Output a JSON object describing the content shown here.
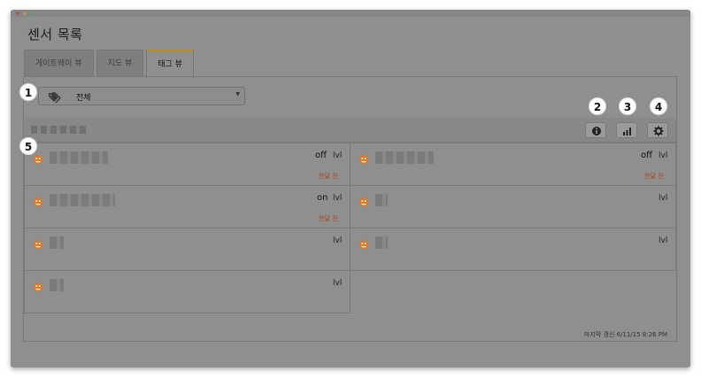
{
  "page": {
    "title": "센서 목록"
  },
  "tabs": [
    {
      "label": "게이트웨이 뷰"
    },
    {
      "label": "지도 뷰"
    },
    {
      "label": "태그 뷰"
    }
  ],
  "filter": {
    "selected": "전체"
  },
  "callouts": [
    "1",
    "2",
    "3",
    "4",
    "5"
  ],
  "toolbar": {
    "info_icon": "info-icon",
    "chart_icon": "chart-icon",
    "settings_icon": "gear-icon"
  },
  "sensors": [
    {
      "status": "off",
      "unit": "lvl",
      "time": "한달 전"
    },
    {
      "status": "off",
      "unit": "lvl",
      "time": "한달 전"
    },
    {
      "status": "on",
      "unit": "lvl",
      "time": "한달 전"
    },
    {
      "status": "",
      "unit": "lvl",
      "time": ""
    },
    {
      "status": "",
      "unit": "lvl",
      "time": ""
    },
    {
      "status": "",
      "unit": "lvl",
      "time": ""
    },
    {
      "status": "",
      "unit": "lvl",
      "time": ""
    }
  ],
  "footer": {
    "last_updated": "마지막 갱신 6/11/15 8:26 PM"
  },
  "colors": {
    "tab_accent": "#b68a2e",
    "time_text": "#a14a2a",
    "sensor_icon": "#e07a1f"
  }
}
